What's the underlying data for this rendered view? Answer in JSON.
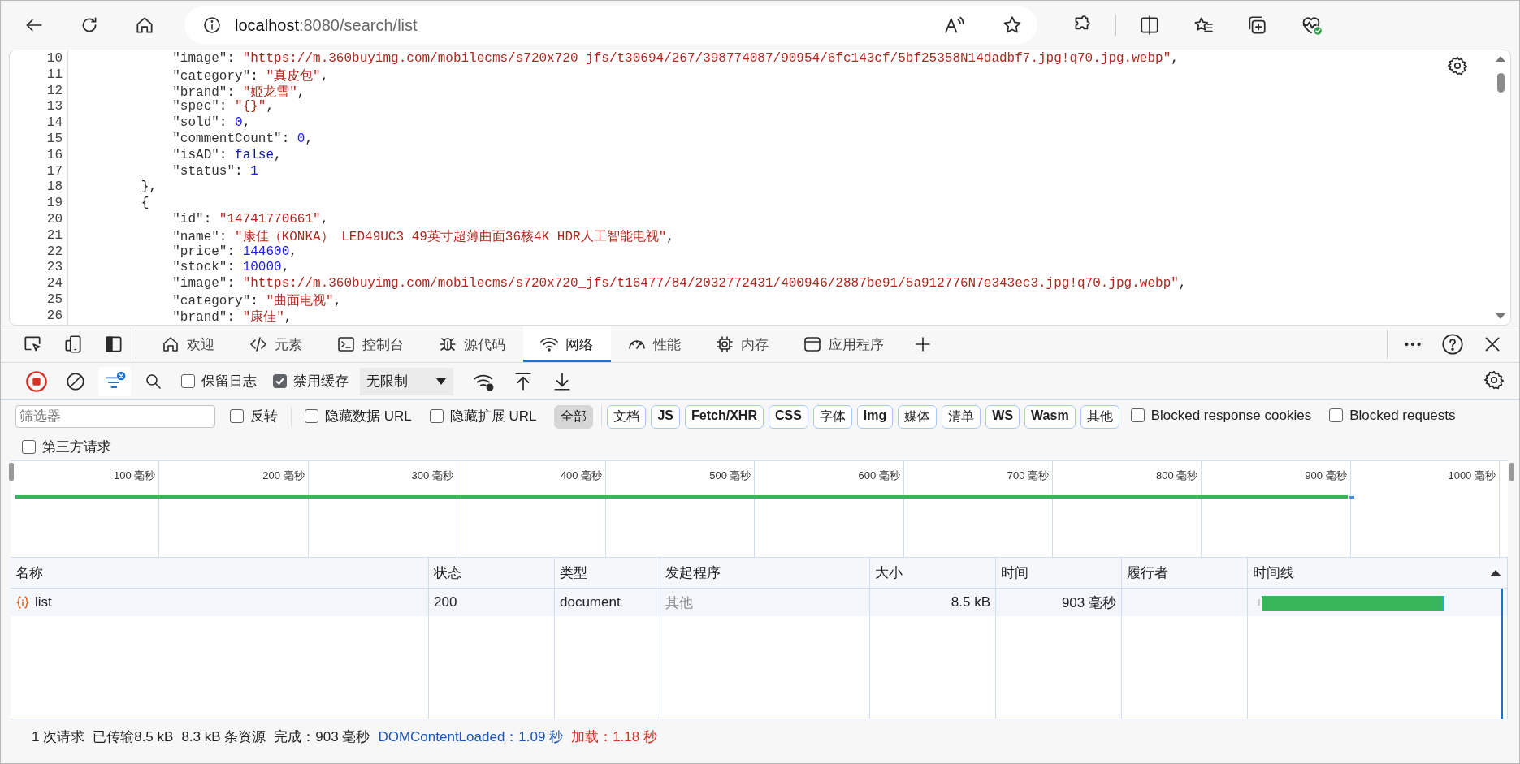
{
  "browser": {
    "url_host": "localhost",
    "url_rest": ":8080/search/list"
  },
  "code_lines": [
    {
      "number": "10",
      "kind": "member",
      "tokens": [
        {
          "kind": "key",
          "text": "\"image\""
        },
        {
          "kind": "punct",
          "text": ": "
        },
        {
          "kind": "string",
          "text": "\"https://m.360buyimg.com/mobilecms/s720x720_jfs/t30694/267/398774087/90954/6fc143cf/5bf25358N14dadbf7.jpg!q70.jpg.webp\""
        },
        {
          "kind": "punct",
          "text": ","
        }
      ]
    },
    {
      "number": "11",
      "kind": "member",
      "tokens": [
        {
          "kind": "key",
          "text": "\"category\""
        },
        {
          "kind": "punct",
          "text": ": "
        },
        {
          "kind": "string",
          "text": "\"真皮包\""
        },
        {
          "kind": "punct",
          "text": ","
        }
      ]
    },
    {
      "number": "12",
      "kind": "member",
      "tokens": [
        {
          "kind": "key",
          "text": "\"brand\""
        },
        {
          "kind": "punct",
          "text": ": "
        },
        {
          "kind": "string",
          "text": "\"姬龙雪\""
        },
        {
          "kind": "punct",
          "text": ","
        }
      ]
    },
    {
      "number": "13",
      "kind": "member",
      "tokens": [
        {
          "kind": "key",
          "text": "\"spec\""
        },
        {
          "kind": "punct",
          "text": ": "
        },
        {
          "kind": "string",
          "text": "\"{}\""
        },
        {
          "kind": "punct",
          "text": ","
        }
      ]
    },
    {
      "number": "14",
      "kind": "member",
      "tokens": [
        {
          "kind": "key",
          "text": "\"sold\""
        },
        {
          "kind": "punct",
          "text": ": "
        },
        {
          "kind": "number",
          "text": "0"
        },
        {
          "kind": "punct",
          "text": ","
        }
      ]
    },
    {
      "number": "15",
      "kind": "member",
      "tokens": [
        {
          "kind": "key",
          "text": "\"commentCount\""
        },
        {
          "kind": "punct",
          "text": ": "
        },
        {
          "kind": "number",
          "text": "0"
        },
        {
          "kind": "punct",
          "text": ","
        }
      ]
    },
    {
      "number": "16",
      "kind": "member",
      "tokens": [
        {
          "kind": "key",
          "text": "\"isAD\""
        },
        {
          "kind": "punct",
          "text": ": "
        },
        {
          "kind": "keyword",
          "text": "false"
        },
        {
          "kind": "punct",
          "text": ","
        }
      ]
    },
    {
      "number": "17",
      "kind": "member",
      "tokens": [
        {
          "kind": "key",
          "text": "\"status\""
        },
        {
          "kind": "punct",
          "text": ": "
        },
        {
          "kind": "number",
          "text": "1"
        }
      ]
    },
    {
      "number": "18",
      "kind": "brace",
      "tokens": [
        {
          "kind": "punct",
          "text": "},"
        }
      ]
    },
    {
      "number": "19",
      "kind": "brace",
      "tokens": [
        {
          "kind": "punct",
          "text": "{"
        }
      ]
    },
    {
      "number": "20",
      "kind": "member",
      "tokens": [
        {
          "kind": "key",
          "text": "\"id\""
        },
        {
          "kind": "punct",
          "text": ": "
        },
        {
          "kind": "string",
          "text": "\"14741770661\""
        },
        {
          "kind": "punct",
          "text": ","
        }
      ]
    },
    {
      "number": "21",
      "kind": "member",
      "tokens": [
        {
          "kind": "key",
          "text": "\"name\""
        },
        {
          "kind": "punct",
          "text": ": "
        },
        {
          "kind": "string",
          "text": "\"康佳（KONKA） LED49UC3 49英寸超薄曲面36核4K HDR人工智能电视\""
        },
        {
          "kind": "punct",
          "text": ","
        }
      ]
    },
    {
      "number": "22",
      "kind": "member",
      "tokens": [
        {
          "kind": "key",
          "text": "\"price\""
        },
        {
          "kind": "punct",
          "text": ": "
        },
        {
          "kind": "number",
          "text": "144600"
        },
        {
          "kind": "punct",
          "text": ","
        }
      ]
    },
    {
      "number": "23",
      "kind": "member",
      "tokens": [
        {
          "kind": "key",
          "text": "\"stock\""
        },
        {
          "kind": "punct",
          "text": ": "
        },
        {
          "kind": "number",
          "text": "10000"
        },
        {
          "kind": "punct",
          "text": ","
        }
      ]
    },
    {
      "number": "24",
      "kind": "member",
      "tokens": [
        {
          "kind": "key",
          "text": "\"image\""
        },
        {
          "kind": "punct",
          "text": ": "
        },
        {
          "kind": "string",
          "text": "\"https://m.360buyimg.com/mobilecms/s720x720_jfs/t16477/84/2032772431/400946/2887be91/5a912776N7e343ec3.jpg!q70.jpg.webp\""
        },
        {
          "kind": "punct",
          "text": ","
        }
      ]
    },
    {
      "number": "25",
      "kind": "member",
      "tokens": [
        {
          "kind": "key",
          "text": "\"category\""
        },
        {
          "kind": "punct",
          "text": ": "
        },
        {
          "kind": "string",
          "text": "\"曲面电视\""
        },
        {
          "kind": "punct",
          "text": ","
        }
      ]
    },
    {
      "number": "26",
      "kind": "member",
      "tokens": [
        {
          "kind": "key",
          "text": "\"brand\""
        },
        {
          "kind": "punct",
          "text": ": "
        },
        {
          "kind": "string",
          "text": "\"康佳\""
        },
        {
          "kind": "punct",
          "text": ","
        }
      ]
    }
  ],
  "devtools": {
    "tabs": [
      {
        "label": "欢迎",
        "selected": false
      },
      {
        "label": "元素",
        "selected": false
      },
      {
        "label": "控制台",
        "selected": false
      },
      {
        "label": "源代码",
        "selected": false
      },
      {
        "label": "网络",
        "selected": true
      },
      {
        "label": "性能",
        "selected": false
      },
      {
        "label": "内存",
        "selected": false
      },
      {
        "label": "应用程序",
        "selected": false
      }
    ],
    "recording": true,
    "filters_shown": true,
    "preserve_log": {
      "label": "保留日志",
      "checked": false
    },
    "disable_cache": {
      "label": "禁用缓存",
      "checked": true
    },
    "throttling": {
      "value": "无限制"
    },
    "filter": {
      "placeholder": "筛选器"
    },
    "filter_checks": [
      {
        "label": "反转",
        "checked": false
      },
      {
        "label": "隐藏数据 URL",
        "checked": false
      },
      {
        "label": "隐藏扩展 URL",
        "checked": false
      }
    ],
    "type_chips": [
      {
        "label": "全部",
        "selected": true
      },
      {
        "label": "文档",
        "selected": false
      },
      {
        "label": "JS",
        "selected": false
      },
      {
        "label": "Fetch/XHR",
        "selected": false
      },
      {
        "label": "CSS",
        "selected": false
      },
      {
        "label": "字体",
        "selected": false
      },
      {
        "label": "Img",
        "selected": false
      },
      {
        "label": "媒体",
        "selected": false
      },
      {
        "label": "清单",
        "selected": false
      },
      {
        "label": "WS",
        "selected": false
      },
      {
        "label": "Wasm",
        "selected": false
      },
      {
        "label": "其他",
        "selected": false
      }
    ],
    "extra_checks": [
      {
        "label": "Blocked response cookies",
        "checked": false
      },
      {
        "label": "Blocked requests",
        "checked": false
      }
    ],
    "third_party": {
      "label": "第三方请求",
      "checked": false
    },
    "overview_ticks": [
      "100 毫秒",
      "200 毫秒",
      "300 毫秒",
      "400 毫秒",
      "500 毫秒",
      "600 毫秒",
      "700 毫秒",
      "800 毫秒",
      "900 毫秒",
      "1000 毫秒"
    ],
    "table": {
      "columns": [
        "名称",
        "状态",
        "类型",
        "发起程序",
        "大小",
        "时间",
        "履行者",
        "时间线"
      ],
      "rows": [
        {
          "name": "list",
          "status": "200",
          "type": "document",
          "initiator": "其他",
          "size": "8.5 kB",
          "time": "903 毫秒"
        }
      ]
    },
    "status_bar": [
      {
        "text": "1 次请求",
        "color": "#202124"
      },
      {
        "text": "已传输8.5 kB",
        "color": "#202124"
      },
      {
        "text": "8.3 kB 条资源",
        "color": "#202124"
      },
      {
        "text": "完成：903 毫秒",
        "color": "#202124"
      },
      {
        "text": "DOMContentLoaded：1.09 秒",
        "color": "#1a55b5"
      },
      {
        "text": "加载：1.18 秒",
        "color": "#d93025"
      }
    ]
  }
}
